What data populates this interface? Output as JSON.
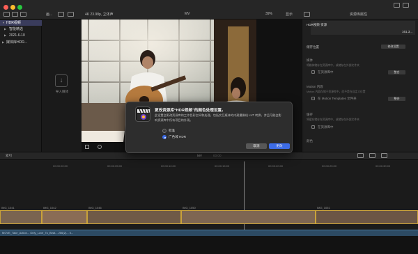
{
  "window": {
    "traffic_colors": [
      "#ff5f57",
      "#febc2e",
      "#28c840"
    ]
  },
  "toolbar": {
    "browser_menu": "画...",
    "format_info": "4K 23.98p, 立体声",
    "viewer_title": "MV",
    "zoom": "39%",
    "view_menu": "显示",
    "inspector_title": "资源库属性"
  },
  "library": {
    "items": [
      {
        "label": "HDR视频",
        "selected": true
      },
      {
        "label": "智能精选",
        "selected": false
      },
      {
        "label": "2021-6-10",
        "selected": false
      },
      {
        "label": "媒体库HDR...",
        "selected": false
      }
    ]
  },
  "media": {
    "import_label": "导入媒体"
  },
  "inspector": {
    "library_name": "HDR视频·资源",
    "size": "161.3...",
    "storage_label": "储存位置",
    "storage_button": "修改设置",
    "media_label": "媒体",
    "media_desc": "将媒体储存在资源库中，或储存在外部文件夹",
    "consolidate_label": "在资源库中",
    "consolidate_button": "整合",
    "motion_label": "Motion 内容",
    "motion_desc": "Motion 内容存储于资源库中，而不是在自定义位置",
    "motion_check": "在 Motion Templates 文件夹",
    "motion_button": "整合",
    "cache_label": "缓存",
    "cache_desc": "将缓存储存在资源库中，或储存在外部文件夹",
    "cache_check": "在资源库中",
    "color_label": "颜色"
  },
  "timeline": {
    "index_label": "索引",
    "project_name": "MV",
    "timecode": "00:00",
    "ticks": [
      "00:00:00:00",
      "00:00:05:00",
      "00:00:10:00",
      "00:00:15:00",
      "00:00:20:00",
      "00:00:25:00",
      "00:00:30:00"
    ],
    "clip_labels": [
      "IMG_1041",
      "IMG_1042",
      "IMG_1046",
      "IMG_1050",
      "IMG_1051"
    ],
    "audio_label": "MOVE_Take_Action... Only_Love_To_Beat... 256(2)... 0..."
  },
  "dialog": {
    "title": "更改资源库“HDR视频”的颜色处理设置。",
    "body": "此设置会更改资源库的工作色彩空间和处理。包括交互媒体的内建摄像机 LUT 转换，并且可能会影响资源库中所有项目的外观。",
    "option_standard": "标准",
    "option_wide": "广色域 HDR",
    "cancel": "取消",
    "change": "更改",
    "accent": "#3d6ce6"
  }
}
